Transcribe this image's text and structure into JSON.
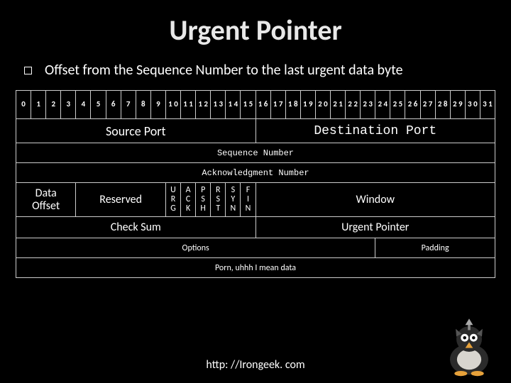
{
  "title": "Urgent Pointer",
  "bullet": "Offset from the Sequence Number to the last urgent data byte",
  "bits": [
    "0",
    "1",
    "2",
    "3",
    "4",
    "5",
    "6",
    "7",
    "8",
    "9",
    "1 0",
    "1 1",
    "1 2",
    "1 3",
    "1 4",
    "1 5",
    "1 6",
    "1 7",
    "1 8",
    "1 9",
    "2 0",
    "2 1",
    "2 2",
    "2 3",
    "2 4",
    "2 5",
    "2 6",
    "2 7",
    "2 8",
    "2 9",
    "3 0",
    "3 1"
  ],
  "source_port": "Source Port",
  "dest_port": "Destination Port",
  "seq": "Sequence Number",
  "ack": "Acknowledgment Number",
  "data_offset": "Data\nOffset",
  "reserved": "Reserved",
  "flags": {
    "urg": "U\nR\nG",
    "ack": "A\nC\nK",
    "psh": "P\nS\nH",
    "rst": "R\nS\nT",
    "syn": "S\nY\nN",
    "fin": "F\nI\nN"
  },
  "window": "Window",
  "checksum": "Check Sum",
  "urgent_pointer": "Urgent Pointer",
  "options": "Options",
  "padding": "Padding",
  "payload": "Porn, uhhh I mean data",
  "footer": "http: //Irongeek. com"
}
